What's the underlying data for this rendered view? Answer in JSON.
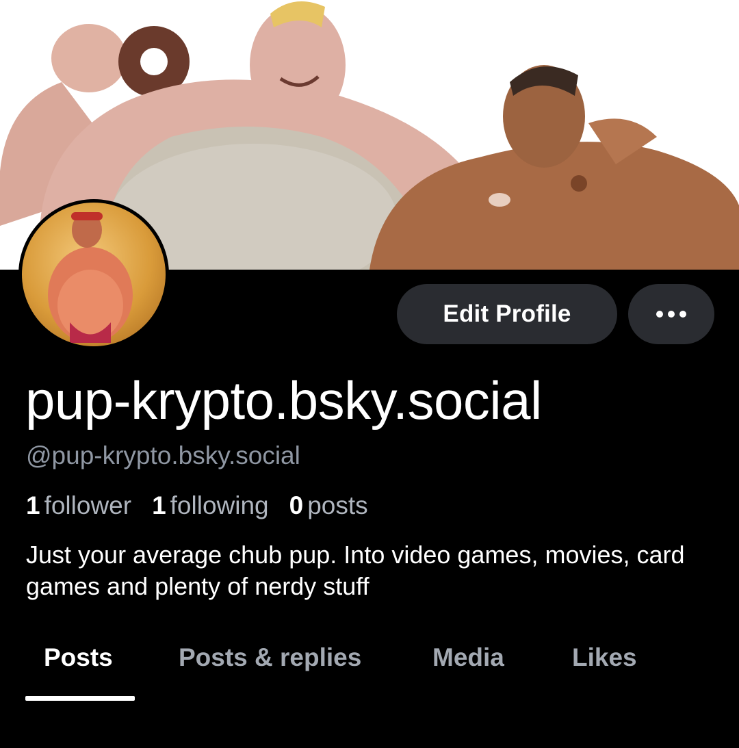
{
  "profile": {
    "display_name": "pup-krypto.bsky.social",
    "handle": "@pup-krypto.bsky.social",
    "stats": {
      "followers_count": "1",
      "followers_label": "follower",
      "following_count": "1",
      "following_label": "following",
      "posts_count": "0",
      "posts_label": "posts"
    },
    "bio": "Just your average chub pup. Into video games, movies, card games and plenty of nerdy stuff"
  },
  "actions": {
    "edit_label": "Edit Profile",
    "more_icon": "ellipsis-icon"
  },
  "tabs": [
    {
      "label": "Posts",
      "active": true
    },
    {
      "label": "Posts & replies",
      "active": false
    },
    {
      "label": "Media",
      "active": false
    },
    {
      "label": "Likes",
      "active": false
    }
  ],
  "colors": {
    "background": "#000000",
    "button_bg": "#2a2c31",
    "muted_text": "#8f97a3"
  }
}
